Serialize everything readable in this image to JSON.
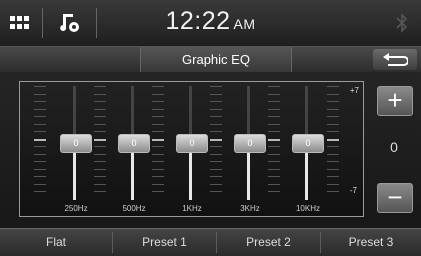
{
  "status": {
    "time": "12:22",
    "ampm": "AM"
  },
  "header": {
    "title": "Graphic EQ"
  },
  "eq": {
    "bands": [
      {
        "freq": "250Hz",
        "value": "0"
      },
      {
        "freq": "500Hz",
        "value": "0"
      },
      {
        "freq": "1KHz",
        "value": "0"
      },
      {
        "freq": "3KHz",
        "value": "0"
      },
      {
        "freq": "10KHz",
        "value": "0"
      }
    ],
    "scale_max": "+7",
    "scale_min": "-7"
  },
  "side": {
    "plus": "+",
    "minus": "−",
    "value": "0"
  },
  "presets": [
    "Flat",
    "Preset 1",
    "Preset 2",
    "Preset 3"
  ],
  "colors": {
    "accent": "#ffffff",
    "bg": "#1a1a1a"
  }
}
